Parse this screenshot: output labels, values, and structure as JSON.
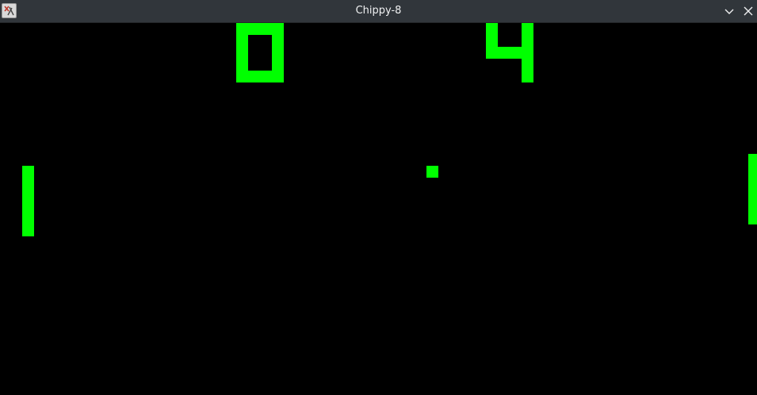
{
  "window": {
    "title": "Chippy-8",
    "app_icon": "chippy-8-app-icon",
    "controls": {
      "minimize_icon": "chevron-down-icon",
      "close_icon": "close-icon"
    }
  },
  "game": {
    "name": "Pong",
    "score_left": "0",
    "score_right": "4",
    "pixel_color": "#00ff00",
    "background_color": "#000000"
  }
}
